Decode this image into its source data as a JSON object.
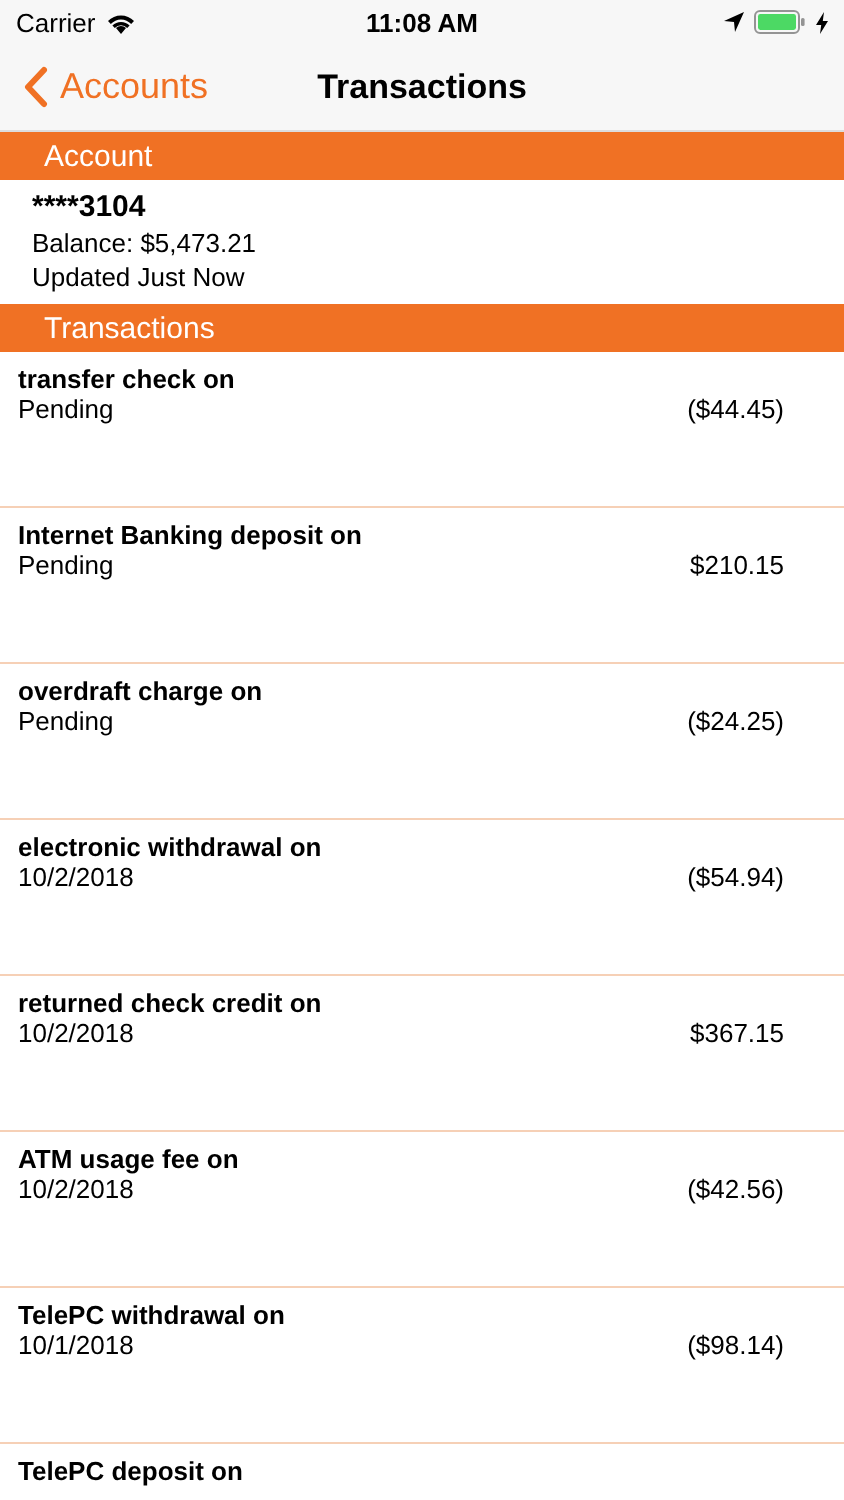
{
  "status_bar": {
    "carrier": "Carrier",
    "time": "11:08 AM"
  },
  "nav_bar": {
    "back_label": "Accounts",
    "title": "Transactions"
  },
  "account_section": {
    "header": "Account",
    "account_number": "****3104",
    "balance": "Balance: $5,473.21",
    "updated": "Updated Just Now"
  },
  "transactions_section": {
    "header": "Transactions",
    "rows": [
      {
        "description": "transfer check on",
        "date": "Pending",
        "amount": "($44.45)"
      },
      {
        "description": "Internet Banking deposit on",
        "date": "Pending",
        "amount": "$210.15"
      },
      {
        "description": "overdraft charge on",
        "date": "Pending",
        "amount": "($24.25)"
      },
      {
        "description": "electronic withdrawal on",
        "date": "10/2/2018",
        "amount": "($54.94)"
      },
      {
        "description": "returned check credit on",
        "date": "10/2/2018",
        "amount": "$367.15"
      },
      {
        "description": "ATM usage fee on",
        "date": "10/2/2018",
        "amount": "($42.56)"
      },
      {
        "description": "TelePC withdrawal on",
        "date": "10/1/2018",
        "amount": "($98.14)"
      },
      {
        "description": "TelePC deposit on"
      }
    ]
  }
}
